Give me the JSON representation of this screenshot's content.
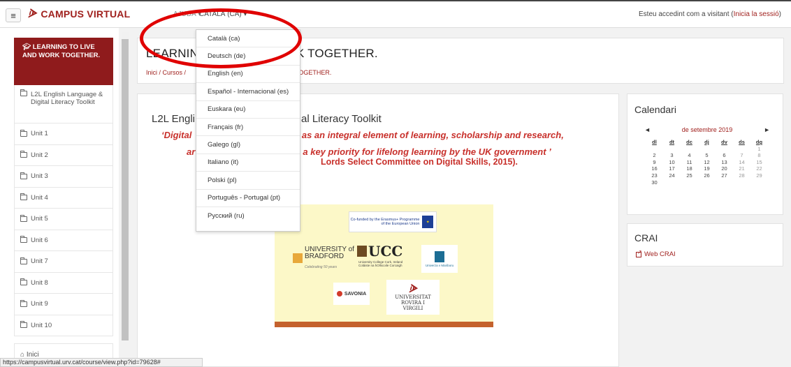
{
  "navbar": {
    "brand_logo": "ᗇ",
    "brand": "CAMPUS VIRTUAL",
    "help": "AJUDA ▾",
    "language": "CATALÀ (CA) ▾",
    "login_prefix": "Esteu accedint com a visitant (",
    "login_link": "Inicia la sessió",
    "login_suffix": ")"
  },
  "sidebar": {
    "header": "LEARNING TO LIVE AND WORK TOGETHER.",
    "items": [
      {
        "label": "L2L English Language & Digital Literacy Toolkit"
      },
      {
        "label": "Unit 1"
      },
      {
        "label": "Unit 2"
      },
      {
        "label": "Unit 3"
      },
      {
        "label": "Unit 4"
      },
      {
        "label": "Unit 5"
      },
      {
        "label": "Unit 6"
      },
      {
        "label": "Unit 7"
      },
      {
        "label": "Unit 8"
      },
      {
        "label": "Unit 9"
      },
      {
        "label": "Unit 10"
      }
    ],
    "home": "Inici"
  },
  "header": {
    "title": "LEARNIN",
    "title_end": "ORK TOGETHER.",
    "breadcrumb": "Inici / Cursos /",
    "breadcrumb_end": "TOGETHER."
  },
  "main": {
    "course_title": "L2L Engli",
    "course_title_end": "al Literacy Toolkit",
    "quote1_start": "‘Digital",
    "quote1_end": "gnised as an integral element of learning, scholarship and research,",
    "quote2_start": "ar",
    "quote2_end": "as a key priority for lifelong learning by the UK government ’",
    "quote3": "Lords Select Committee on Digital Skills, 2015)."
  },
  "logos": {
    "eu": "Co-funded by the Erasmus+ Programme of the European Union",
    "bradford": "UNIVERSITY of BRADFORD",
    "bradford_sub": "Celebrating 50 years",
    "ucc": "UCC",
    "ucc_sub": "University College Cork, Ireland Coláiste na hOllscoile Corcaigh",
    "maribor": "Univerza v Mariboru",
    "savonia": "SAVONIA",
    "rovira_logo": "ᗇ",
    "rovira": "UNIVERSITAT ROVIRA I VIRGILI"
  },
  "calendar": {
    "title": "Calendari",
    "prev": "◄",
    "month": "de setembre 2019",
    "next": "►",
    "weekdays": [
      "dl",
      "dt",
      "dc",
      "dj",
      "dv",
      "ds",
      "dg"
    ],
    "weeks": [
      [
        "",
        "",
        "",
        "",
        "",
        "",
        "1"
      ],
      [
        "2",
        "3",
        "4",
        "5",
        "6",
        "7",
        "8"
      ],
      [
        "9",
        "10",
        "11",
        "12",
        "13",
        "14",
        "15"
      ],
      [
        "16",
        "17",
        "18",
        "19",
        "20",
        "21",
        "22"
      ],
      [
        "23",
        "24",
        "25",
        "26",
        "27",
        "28",
        "29"
      ],
      [
        "30",
        "",
        "",
        "",
        "",
        "",
        ""
      ]
    ]
  },
  "crai": {
    "title": "CRAI",
    "link": "Web CRAI"
  },
  "language_dropdown": {
    "items": [
      "Català (ca)",
      "Deutsch (de)",
      "English (en)",
      "Español - Internacional (es)",
      "Euskara (eu)",
      "Français (fr)",
      "Galego (gl)",
      "Italiano (it)",
      "Polski (pl)",
      "Português - Portugal (pt)",
      "Русский (ru)"
    ]
  },
  "statusbar": {
    "url": "https://campusvirtual.urv.cat/course/view.php?id=79628#"
  },
  "colors": {
    "brand": "#a0211e",
    "sidebar_header": "#8f1b1c",
    "annotation": "#e00000",
    "quote": "#c8302b"
  }
}
